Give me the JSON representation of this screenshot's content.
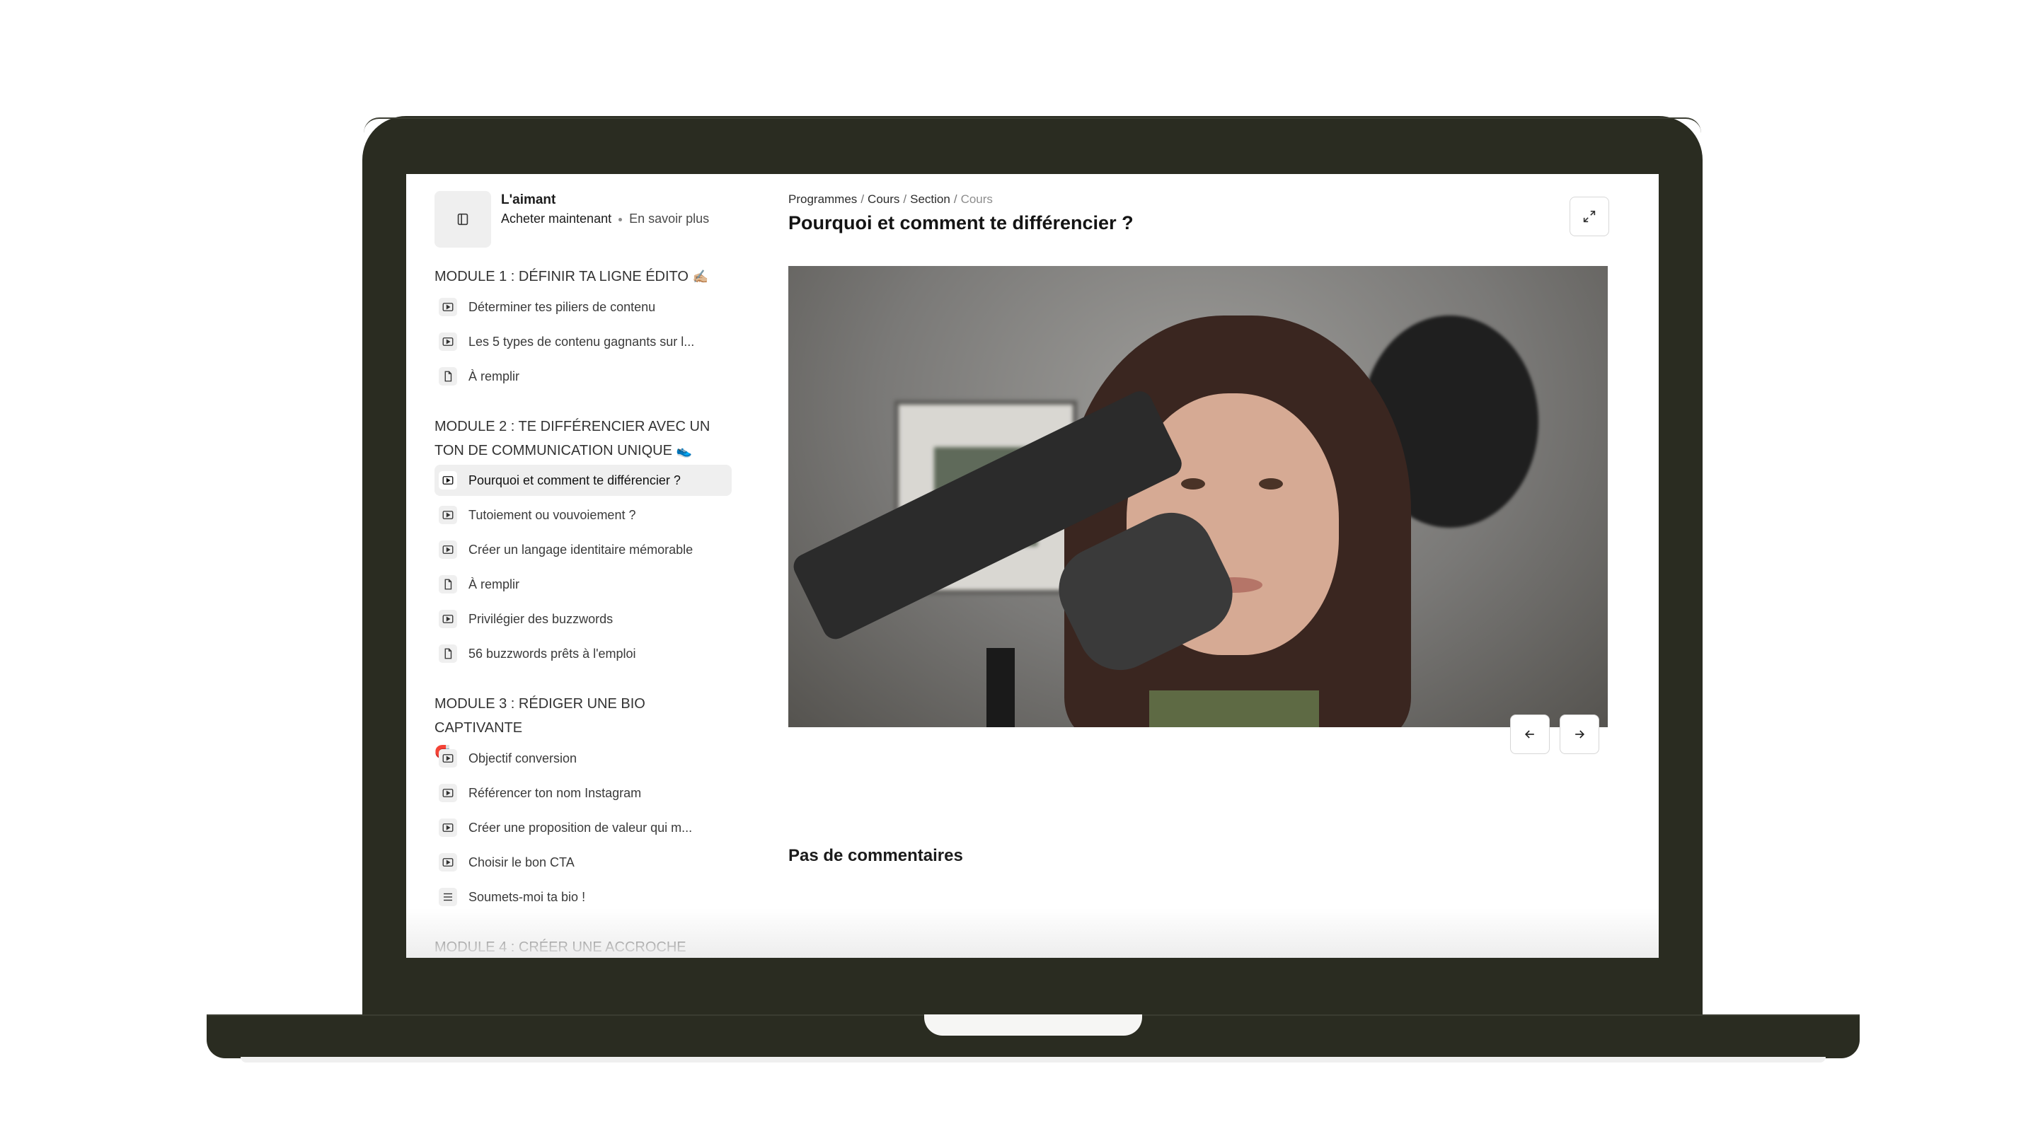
{
  "product": {
    "title": "L'aimant",
    "buy_label": "Acheter maintenant",
    "more_label": "En savoir plus"
  },
  "breadcrumb": {
    "items": [
      "Programmes",
      "Cours",
      "Section"
    ],
    "current": "Cours"
  },
  "lesson_title": "Pourquoi et comment te différencier ?",
  "modules": [
    {
      "title": "MODULE 1 : DÉFINIR TA LIGNE ÉDITO",
      "emoji": "✍🏼",
      "lessons": [
        {
          "label": "Déterminer tes piliers de contenu",
          "icon": "video-icon"
        },
        {
          "label": "Les 5 types de contenu gagnants sur l...",
          "icon": "video-icon"
        },
        {
          "label": "À remplir",
          "icon": "document-icon"
        }
      ]
    },
    {
      "title": "MODULE 2 : TE DIFFÉRENCIER AVEC UN TON DE COMMUNICATION UNIQUE",
      "emoji": "👟",
      "lessons": [
        {
          "label": "Pourquoi et comment te différencier ?",
          "icon": "video-icon",
          "active": true
        },
        {
          "label": "Tutoiement ou vouvoiement ?",
          "icon": "video-icon"
        },
        {
          "label": "Créer un langage identitaire mémorable",
          "icon": "video-icon"
        },
        {
          "label": "À remplir",
          "icon": "document-icon"
        },
        {
          "label": "Privilégier des buzzwords",
          "icon": "video-icon"
        },
        {
          "label": "56 buzzwords prêts à l'emploi",
          "icon": "document-icon"
        }
      ]
    },
    {
      "title": "MODULE 3 : RÉDIGER UNE BIO CAPTIVANTE",
      "emoji": "🧲",
      "lessons": [
        {
          "label": "Objectif conversion",
          "icon": "video-icon"
        },
        {
          "label": "Référencer ton nom Instagram",
          "icon": "video-icon"
        },
        {
          "label": "Créer une proposition de valeur qui m...",
          "icon": "video-icon"
        },
        {
          "label": "Choisir le bon CTA",
          "icon": "video-icon"
        },
        {
          "label": "Soumets-moi ta bio !",
          "icon": "text-lines-icon"
        }
      ]
    },
    {
      "title": "MODULE 4 : CRÉER UNE ACCROCHE",
      "emoji": "",
      "lessons": []
    }
  ],
  "comments_label": "Pas de commentaires",
  "colors": {
    "laptop_body": "#2a2c21",
    "active_item_bg": "#efefef",
    "icon_chip_bg": "#efefef"
  }
}
